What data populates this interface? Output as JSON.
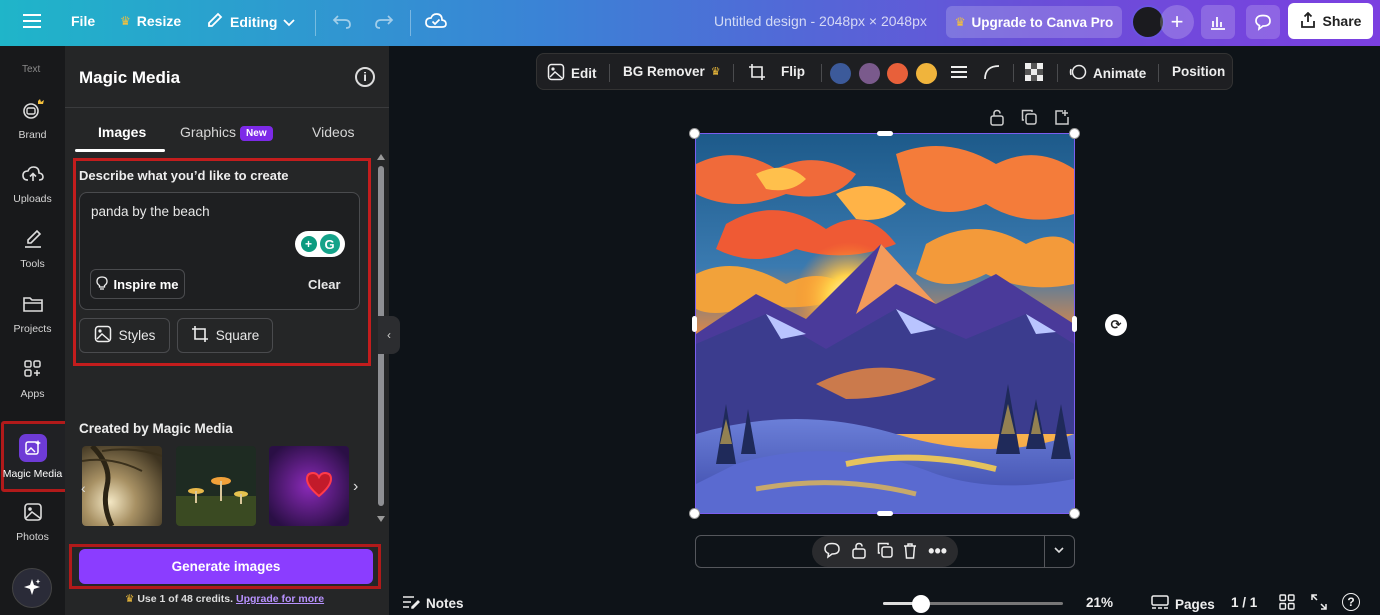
{
  "topbar": {
    "file": "File",
    "resize": "Resize",
    "editing": "Editing",
    "design_title": "Untitled design - 2048px × 2048px",
    "upgrade": "Upgrade to Canva Pro",
    "share": "Share"
  },
  "rail": {
    "text_label": "Text",
    "items": [
      {
        "label": "Brand",
        "icon": "brand-icon"
      },
      {
        "label": "Uploads",
        "icon": "upload-cloud-icon"
      },
      {
        "label": "Tools",
        "icon": "pen-tools-icon"
      },
      {
        "label": "Projects",
        "icon": "folder-icon"
      },
      {
        "label": "Apps",
        "icon": "apps-grid-icon"
      },
      {
        "label": "Magic Media",
        "icon": "magic-media-icon"
      },
      {
        "label": "Photos",
        "icon": "photo-icon"
      }
    ]
  },
  "panel": {
    "title": "Magic Media",
    "tabs": [
      {
        "label": "Images",
        "active": true
      },
      {
        "label": "Graphics",
        "badge": "New"
      },
      {
        "label": "Videos"
      }
    ],
    "describe_label": "Describe what you’d like to create",
    "prompt_value": "panda by the beach",
    "inspire": "Inspire me",
    "clear": "Clear",
    "styles": "Styles",
    "aspect": "Square",
    "created_title": "Created by Magic Media",
    "generate": "Generate images",
    "credits_text": "Use 1 of 48 credits.",
    "credits_link": "Upgrade for more"
  },
  "context_toolbar": {
    "edit": "Edit",
    "bg_remover": "BG Remover",
    "flip": "Flip",
    "colors": [
      "#3c5a9a",
      "#7a5a8c",
      "#e8603a",
      "#f0b43c"
    ],
    "animate": "Animate",
    "position": "Position"
  },
  "bottombar": {
    "notes": "Notes",
    "zoom": "21%",
    "zoom_level": 0.21,
    "pages": "Pages",
    "page_count": "1 / 1"
  },
  "colors": {
    "accent": "#8b3dff",
    "highlight_border": "#c31d1d"
  }
}
